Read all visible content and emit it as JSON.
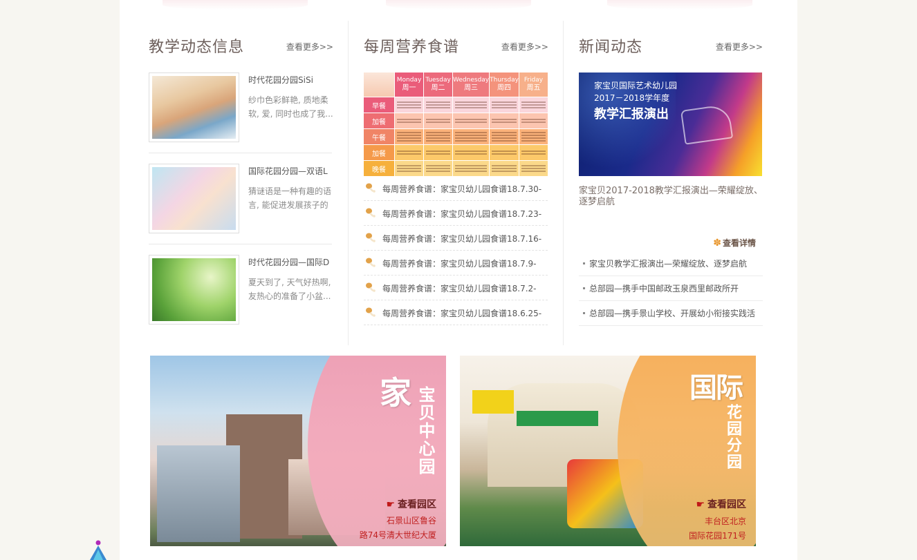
{
  "col1": {
    "title": "教学动态信息",
    "more": "查看更多>>",
    "items": [
      {
        "title": "时代花园分园SiSi",
        "desc": "纱巾色彩鲜艳, 质地柔软, 爱, 同时也成了我..."
      },
      {
        "title": "国际花园分园—双语L",
        "desc": "猜谜语是一种有趣的语言, 能促进发展孩子的思..."
      },
      {
        "title": "时代花园分园—国际D",
        "desc": "夏天到了, 天气好热啊, 友热心的准备了小盆..."
      }
    ]
  },
  "col2": {
    "title": "每周营养食谱",
    "more": "查看更多>>",
    "table": {
      "days": [
        {
          "en": "Monday",
          "zh": "周一"
        },
        {
          "en": "Tuesday",
          "zh": "周二"
        },
        {
          "en": "Wednesday",
          "zh": "周三"
        },
        {
          "en": "Thursday",
          "zh": "周四"
        },
        {
          "en": "Friday",
          "zh": "周五"
        }
      ],
      "meals": [
        "早餐",
        "加餐",
        "午餐",
        "加餐",
        "晚餐"
      ]
    },
    "items": [
      "每周营养食谱：家宝贝幼儿园食谱18.7.30-",
      "每周营养食谱：家宝贝幼儿园食谱18.7.23-",
      "每周营养食谱：家宝贝幼儿园食谱18.7.16-",
      "每周营养食谱：家宝贝幼儿园食谱18.7.9-",
      "每周营养食谱：家宝贝幼儿园食谱18.7.2-",
      "每周营养食谱：家宝贝幼儿园食谱18.6.25-"
    ]
  },
  "col3": {
    "title": "新闻动态",
    "more": "查看更多>>",
    "feature_image_text": {
      "line1": "家宝贝国际艺术幼儿园",
      "line2": "2017－2018学年度",
      "line3": "教学汇报演出"
    },
    "feature_title": "家宝贝2017-2018教学汇报演出—荣耀绽放、逐梦启航",
    "detail": "查看详情",
    "items": [
      "家宝贝教学汇报演出—荣耀绽放、逐梦启航",
      "总部园—携手中国邮政玉泉西里邮政所开",
      "总部园—携手景山学校、开展幼小衔接实践活"
    ]
  },
  "banners": [
    {
      "big": "家",
      "vertical": "宝贝中心园",
      "view": "查看园区",
      "addr1": "石景山区鲁谷",
      "addr2": "路74号清大世纪大厦"
    },
    {
      "big": "国际",
      "vertical": "花园分园",
      "view": "查看园区",
      "addr1": "丰台区北京",
      "addr2": "国际花园171号"
    }
  ],
  "colors": {
    "title": "#6d5f5b",
    "menu_pink": "#ea5c7a",
    "menu_orange": "#f59a4a",
    "menu_yellow": "#f9c25a",
    "banner1_tint": "#f29bb0",
    "banner2_tint": "#f6a64a",
    "address_red": "#c02020"
  },
  "icons": [
    "chevron-double-right-icon",
    "drumstick-icon",
    "flower-icon",
    "pointing-hand-icon"
  ]
}
